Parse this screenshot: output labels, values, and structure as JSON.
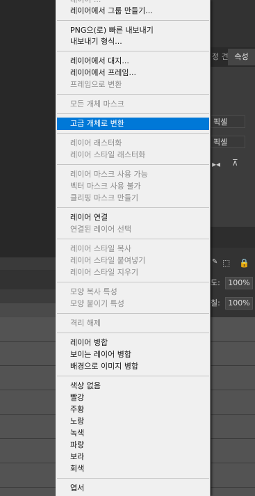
{
  "right_panel": {
    "tab_partial": "정 견",
    "tab_active": "속성",
    "unit_1": "픽셀",
    "unit_2": "픽셀",
    "opacity_label": "도:",
    "opacity_value": "100%",
    "fill_label": "칠:",
    "fill_value": "100%"
  },
  "menu": {
    "top_partial": "레이어 ...",
    "items": [
      {
        "label": "레이어에서 그룹 만들기...",
        "enabled": true
      },
      {
        "label": "PNG으(로) 빠른 내보내기",
        "enabled": true
      },
      {
        "label": "내보내기 형식...",
        "enabled": true
      },
      {
        "label": "레이어에서 대지...",
        "enabled": true
      },
      {
        "label": "레이어에서 프레임...",
        "enabled": true
      },
      {
        "label": "프레임으로 변환",
        "enabled": false
      },
      {
        "label": "모든 개체 마스크",
        "enabled": false
      },
      {
        "label": "고급 개체로 변환",
        "enabled": true,
        "highlighted": true
      },
      {
        "label": "레이어 래스터화",
        "enabled": false
      },
      {
        "label": "레이어 스타일 래스터화",
        "enabled": false
      },
      {
        "label": "레이어 마스크 사용 가능",
        "enabled": false
      },
      {
        "label": "벡터 마스크 사용 불가",
        "enabled": false
      },
      {
        "label": "클리핑 마스크 만들기",
        "enabled": false
      },
      {
        "label": "레이어 연결",
        "enabled": true
      },
      {
        "label": "연결된 레이어 선택",
        "enabled": false
      },
      {
        "label": "레이어 스타일 복사",
        "enabled": false
      },
      {
        "label": "레이어 스타일 붙여넣기",
        "enabled": false
      },
      {
        "label": "레이어 스타일 지우기",
        "enabled": false
      },
      {
        "label": "모양 복사 특성",
        "enabled": false
      },
      {
        "label": "모양 붙이기 특성",
        "enabled": false
      },
      {
        "label": "격리 해제",
        "enabled": false
      },
      {
        "label": "레이어 병합",
        "enabled": true
      },
      {
        "label": "보이는 레이어 병합",
        "enabled": true
      },
      {
        "label": "배경으로 이미지 병합",
        "enabled": true
      },
      {
        "label": "색상 없음",
        "enabled": true
      },
      {
        "label": "빨강",
        "enabled": true
      },
      {
        "label": "주황",
        "enabled": true
      },
      {
        "label": "노랑",
        "enabled": true
      },
      {
        "label": "녹색",
        "enabled": true
      },
      {
        "label": "파랑",
        "enabled": true
      },
      {
        "label": "보라",
        "enabled": true
      },
      {
        "label": "회색",
        "enabled": true
      },
      {
        "label": "엽서",
        "enabled": true
      }
    ]
  },
  "colors": {
    "menu_bg": "#f0f0f0",
    "highlight": "#0078d7",
    "disabled_text": "#8a8a8a"
  }
}
